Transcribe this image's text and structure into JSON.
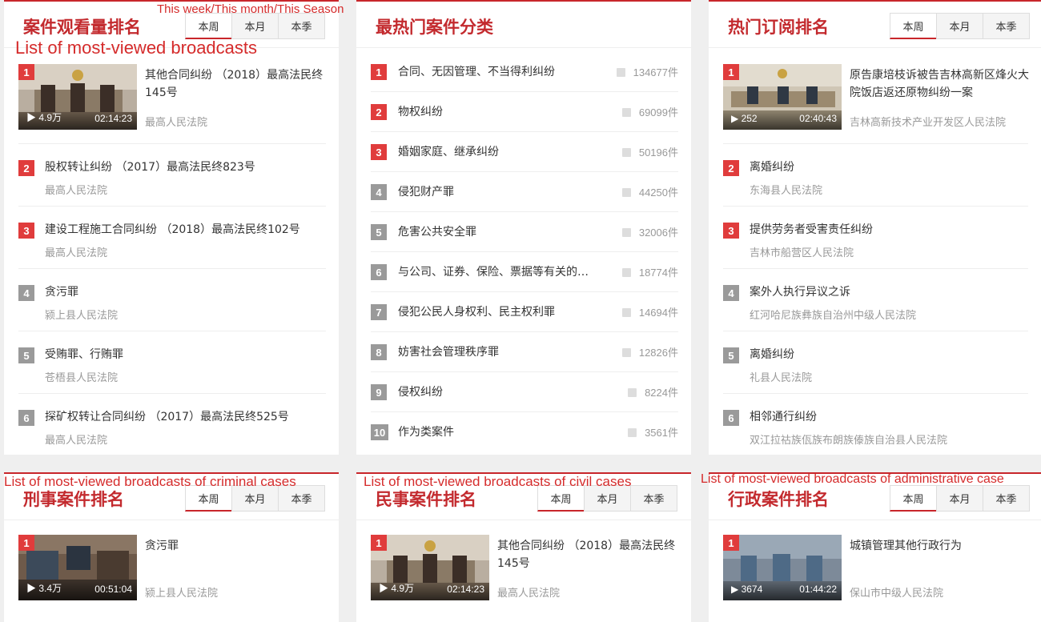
{
  "tabs": [
    "本周",
    "本月",
    "本季"
  ],
  "annotations": {
    "period_tabs": "This week/This month/This Season",
    "most_viewed": "List of most-viewed broadcasts",
    "criminal": "List of most-viewed broadcasts of criminal cases",
    "civil": "List of most-viewed broadcasts of civil cases",
    "administrative": "List of most-viewed broadcasts of administrative case"
  },
  "most_viewed": {
    "title": "案件观看量排名",
    "featured": {
      "rank": "1",
      "title": "其他合同纠纷 （2018）最高法民终145号",
      "court": "最高人民法院",
      "views": "▶ 4.9万",
      "duration": "02:14:23"
    },
    "items": [
      {
        "rank": "2",
        "title": "股权转让纠纷 （2017）最高法民终823号",
        "court": "最高人民法院"
      },
      {
        "rank": "3",
        "title": "建设工程施工合同纠纷 （2018）最高法民终102号",
        "court": "最高人民法院"
      },
      {
        "rank": "4",
        "title": "贪污罪",
        "court": "颍上县人民法院"
      },
      {
        "rank": "5",
        "title": "受贿罪、行贿罪",
        "court": "苍梧县人民法院"
      },
      {
        "rank": "6",
        "title": "探矿权转让合同纠纷 （2017）最高法民终525号",
        "court": "最高人民法院"
      }
    ]
  },
  "categories": {
    "title": "最热门案件分类",
    "items": [
      {
        "rank": "1",
        "name": "合同、无因管理、不当得利纠纷",
        "count": "134677件"
      },
      {
        "rank": "2",
        "name": "物权纠纷",
        "count": "69099件"
      },
      {
        "rank": "3",
        "name": "婚姻家庭、继承纠纷",
        "count": "50196件"
      },
      {
        "rank": "4",
        "name": "侵犯财产罪",
        "count": "44250件"
      },
      {
        "rank": "5",
        "name": "危害公共安全罪",
        "count": "32006件"
      },
      {
        "rank": "6",
        "name": "与公司、证券、保险、票据等有关的民事纠纷",
        "count": "18774件"
      },
      {
        "rank": "7",
        "name": "侵犯公民人身权利、民主权利罪",
        "count": "14694件"
      },
      {
        "rank": "8",
        "name": "妨害社会管理秩序罪",
        "count": "12826件"
      },
      {
        "rank": "9",
        "name": "侵权纠纷",
        "count": "8224件"
      },
      {
        "rank": "10",
        "name": "作为类案件",
        "count": "3561件"
      }
    ]
  },
  "subscriptions": {
    "title": "热门订阅排名",
    "featured": {
      "rank": "1",
      "title": "原告康培枝诉被告吉林高新区烽火大院饭店返还原物纠纷一案",
      "court": "吉林高新技术产业开发区人民法院",
      "views": "▶ 252",
      "duration": "02:40:43"
    },
    "items": [
      {
        "rank": "2",
        "title": "离婚纠纷",
        "court": "东海县人民法院"
      },
      {
        "rank": "3",
        "title": "提供劳务者受害责任纠纷",
        "court": "吉林市船营区人民法院"
      },
      {
        "rank": "4",
        "title": "案外人执行异议之诉",
        "court": "红河哈尼族彝族自治州中级人民法院"
      },
      {
        "rank": "5",
        "title": "离婚纠纷",
        "court": "礼县人民法院"
      },
      {
        "rank": "6",
        "title": "相邻通行纠纷",
        "court": "双江拉祜族佤族布朗族傣族自治县人民法院"
      }
    ]
  },
  "criminal": {
    "title": "刑事案件排名",
    "featured": {
      "rank": "1",
      "title": "贪污罪",
      "court": "颍上县人民法院",
      "views": "▶ 3.4万",
      "duration": "00:51:04"
    }
  },
  "civil": {
    "title": "民事案件排名",
    "featured": {
      "rank": "1",
      "title": "其他合同纠纷 （2018）最高法民终145号",
      "court": "最高人民法院",
      "views": "▶ 4.9万",
      "duration": "02:14:23"
    }
  },
  "administrative": {
    "title": "行政案件排名",
    "featured": {
      "rank": "1",
      "title": "城镇管理其他行政行为",
      "court": "保山市中级人民法院",
      "views": "▶ 3674",
      "duration": "01:44:22"
    }
  }
}
